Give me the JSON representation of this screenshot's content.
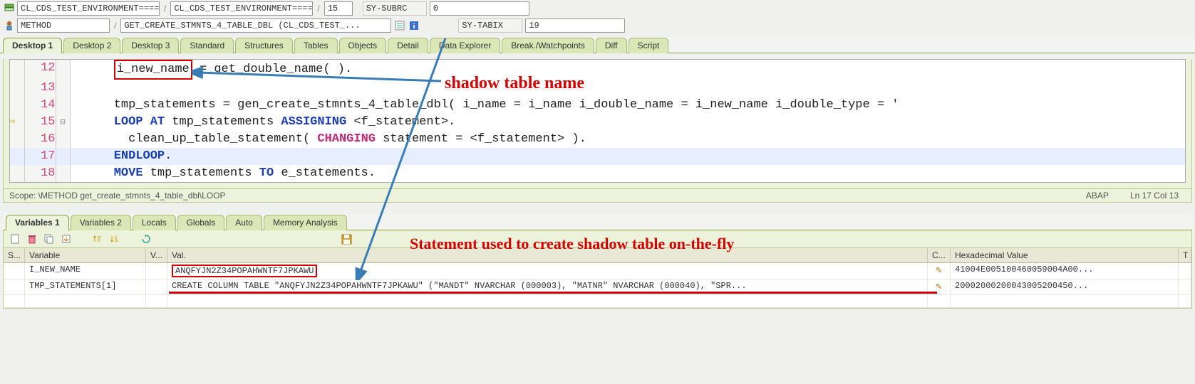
{
  "header": {
    "field1": "CL_CDS_TEST_ENVIRONMENT======...",
    "field2": "CL_CDS_TEST_ENVIRONMENT======...",
    "field3": "15",
    "sysubrc_label": "SY-SUBRC",
    "sysubrc_value": "0",
    "row2_type": "METHOD",
    "row2_method": "GET_CREATE_STMNTS_4_TABLE_DBL (CL_CDS_TEST_...",
    "sytabix_label": "SY-TABIX",
    "sytabix_value": "19"
  },
  "tabs_main": [
    "Desktop 1",
    "Desktop 2",
    "Desktop 3",
    "Standard",
    "Structures",
    "Tables",
    "Objects",
    "Detail",
    "Data Explorer",
    "Break./Watchpoints",
    "Diff",
    "Script"
  ],
  "tabs_main_active": 0,
  "code": {
    "lines": [
      "12",
      "13",
      "14",
      "15",
      "16",
      "17",
      "18"
    ],
    "l12_boxed": "i_new_name",
    "l12_after": " = get_double_name( ).",
    "l14": "tmp_statements = gen_create_stmnts_4_table_dbl( i_name = i_name i_double_name = i_new_name i_double_type = '",
    "l15_kw1": "LOOP AT",
    "l15_mid": " tmp_statements ",
    "l15_kw2": "ASSIGNING",
    "l15_end": " <f_statement>.",
    "l16_pre": "  clean_up_table_statement( ",
    "l16_kw": "CHANGING",
    "l16_post": " statement = <f_statement> ).",
    "l17": "ENDLOOP",
    "l17_dot": ".",
    "l18_kw1": "MOVE",
    "l18_mid": " tmp_statements ",
    "l18_kw2": "TO",
    "l18_end": " e_statements."
  },
  "scope": {
    "text": "Scope: \\METHOD get_create_stmnts_4_table_dbl\\LOOP",
    "lang": "ABAP",
    "pos": "Ln  17 Col  13"
  },
  "tabs_vars": [
    "Variables 1",
    "Variables 2",
    "Locals",
    "Globals",
    "Auto",
    "Memory Analysis"
  ],
  "tabs_vars_active": 0,
  "vars": {
    "columns": {
      "s": "S...",
      "var": "Variable",
      "v": "V...",
      "val": "Val.",
      "c": "C...",
      "hex": "Hexadecimal Value",
      "t": "T"
    },
    "rows": [
      {
        "var": "I_NEW_NAME",
        "val": "ANQFYJN2Z34POPAHWNTF7JPKAWU",
        "hex": "41004E005100460059004A00..."
      },
      {
        "var": "TMP_STATEMENTS[1]",
        "val": "   CREATE     COLUMN TABLE \"ANQFYJN2Z34POPAHWNTF7JPKAWU\"    (\"MANDT\" NVARCHAR (000003),    \"MATNR\" NVARCHAR (000040),    \"SPR...",
        "hex": "20002000200043005200450..."
      }
    ]
  },
  "annotations": {
    "a1": "shadow table name",
    "a2": "Statement used to create shadow table on-the-fly"
  }
}
